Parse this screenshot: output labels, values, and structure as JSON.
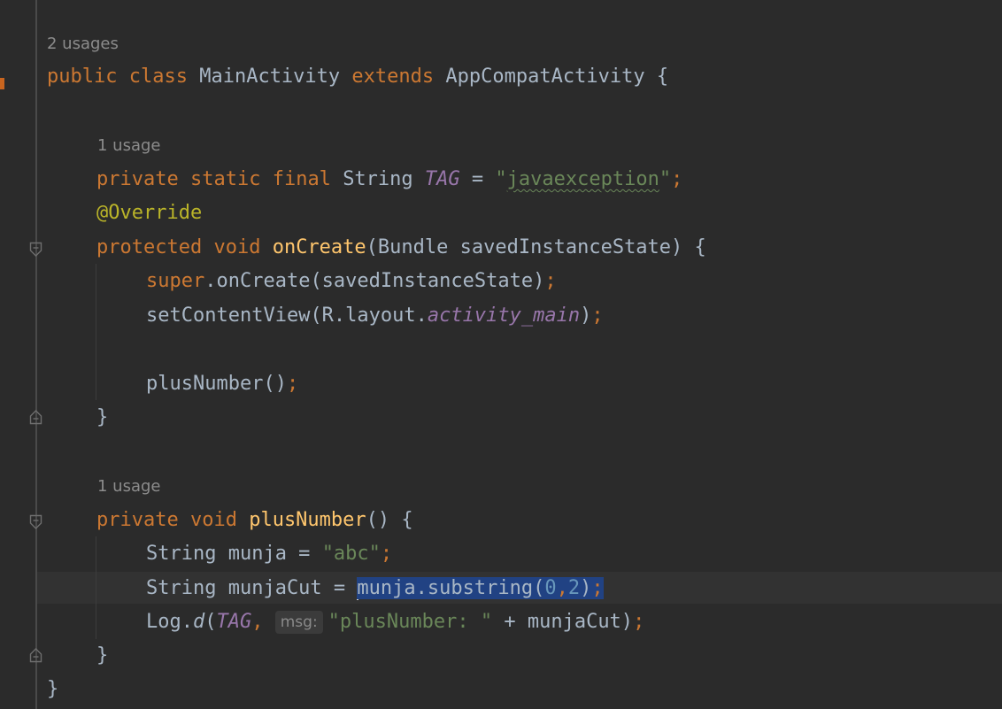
{
  "usages": {
    "class": "2 usages",
    "tag_field": "1 usage",
    "plus_number": "1 usage"
  },
  "code": {
    "l_class": {
      "kw_public": "public",
      "kw_class": "class",
      "name": "MainActivity",
      "kw_extends": "extends",
      "parent": "AppCompatActivity",
      "brace": "{"
    },
    "l_tag": {
      "kw_private": "private",
      "kw_static": "static",
      "kw_final": "final",
      "type": "String",
      "name": "TAG",
      "eq": "=",
      "q_open": "\"",
      "value": "javaexception",
      "q_close": "\"",
      "semi": ";"
    },
    "l_override": {
      "annotation": "@Override"
    },
    "l_oncreate": {
      "kw_protected": "protected",
      "kw_void": "void",
      "name": "onCreate",
      "params": "(Bundle savedInstanceState) {"
    },
    "l_super": {
      "kw_super": "super",
      "call": ".onCreate(savedInstanceState)",
      "semi": ";"
    },
    "l_setcontent": {
      "call": "setContentView(R.layout.",
      "field": "activity_main",
      "close": ")",
      "semi": ";"
    },
    "l_plus_call": {
      "call": "plusNumber()",
      "semi": ";"
    },
    "l_close1": {
      "brace": "}"
    },
    "l_plus_decl": {
      "kw_private": "private",
      "kw_void": "void",
      "name": "plusNumber",
      "params": "() {"
    },
    "l_munja": {
      "decl": "String munja = ",
      "value": "\"abc\"",
      "semi": ";"
    },
    "l_munjacut": {
      "decl": "String munjaCut = ",
      "sel_call": "munja.substring(",
      "arg1": "0",
      "comma": ",",
      "arg2": "2",
      "sel_close": ")",
      "semi": ";"
    },
    "l_log": {
      "obj": "Log.",
      "method": "d",
      "open": "(",
      "tag": "TAG",
      "comma": ", ",
      "hint": "msg:",
      "msg": "\"plusNumber: \"",
      "rest": " + munjaCut)",
      "semi": ";"
    },
    "l_close2": {
      "brace": "}"
    },
    "l_close_class": {
      "brace": "}"
    }
  },
  "colors": {
    "background": "#2b2b2b",
    "keyword": "#cc7832",
    "function": "#ffc66d",
    "string": "#6a8759",
    "field": "#9876aa",
    "annotation": "#bbb529",
    "number": "#6897bb",
    "selection": "#214283",
    "text": "#a9b7c6"
  }
}
